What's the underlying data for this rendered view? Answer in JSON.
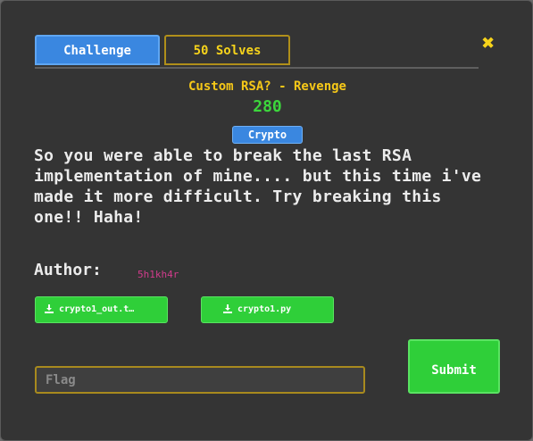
{
  "tabs": {
    "challenge": "Challenge",
    "solves": "50 Solves"
  },
  "close": "✖",
  "challenge": {
    "title": "Custom RSA? - Revenge",
    "points": "280",
    "category": "Crypto",
    "description": "So you were able to break the last RSA implementation of mine.... but this time i've made it more difficult. Try breaking this one!! Haha!",
    "author_label": "Author:",
    "author": "5h1kh4r"
  },
  "files": [
    {
      "name": "crypto1_out.t…"
    },
    {
      "name": "crypto1.py"
    }
  ],
  "form": {
    "flag_placeholder": "Flag",
    "submit_label": "Submit"
  },
  "colors": {
    "accent_blue": "#3a87e0",
    "accent_yellow": "#f6d31b",
    "accent_green": "#2fcf39",
    "author_pink": "#d23c8c"
  }
}
